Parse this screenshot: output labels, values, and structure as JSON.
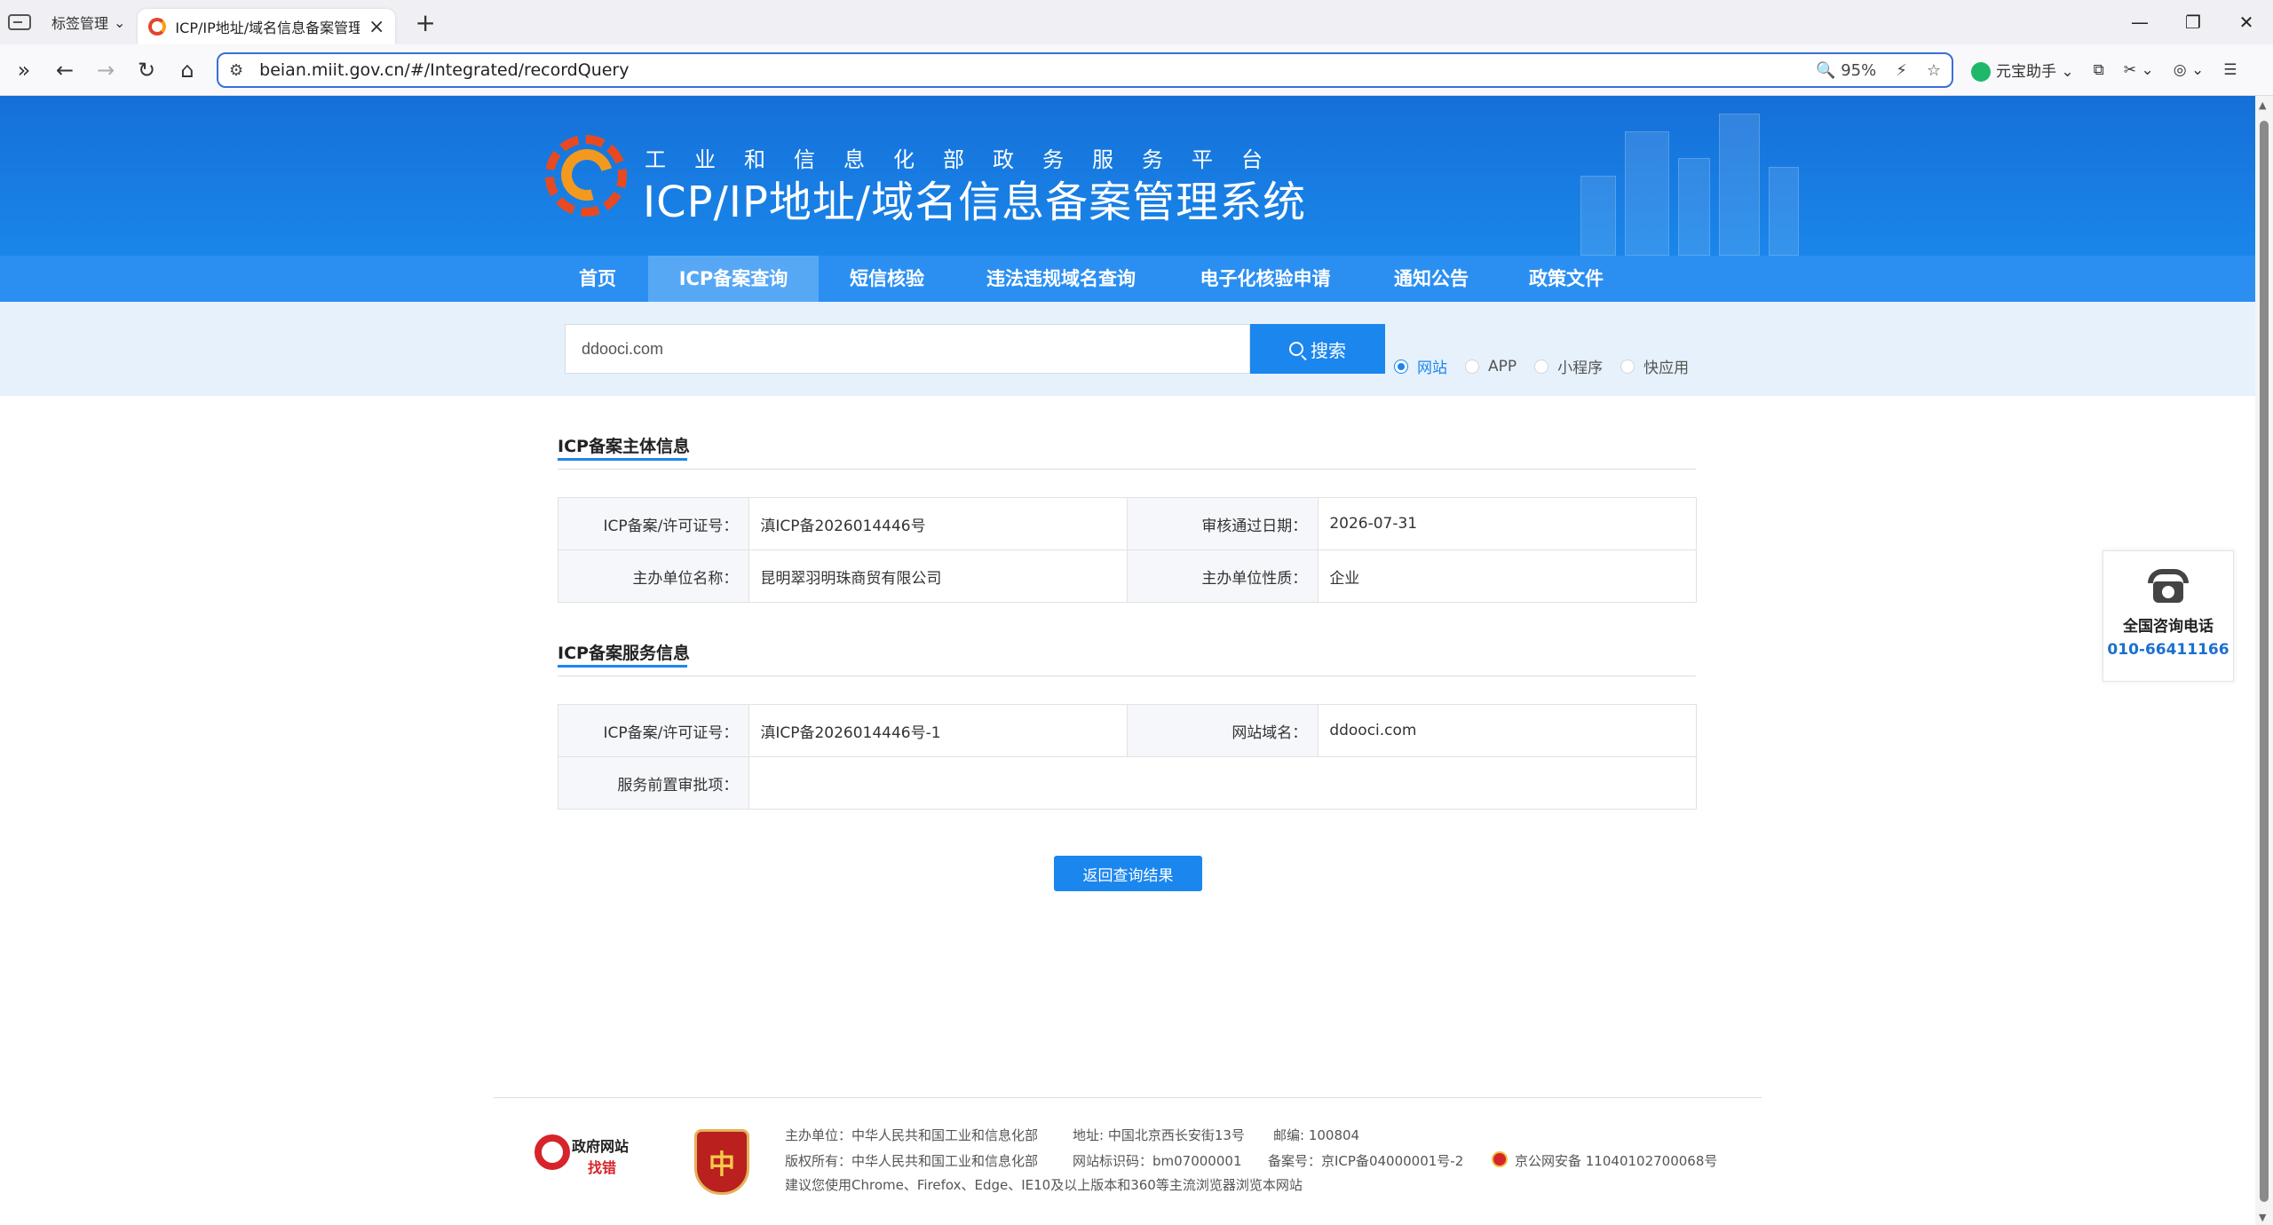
{
  "browser": {
    "tab_group_label": "标签管理",
    "active_tab_title": "ICP/IP地址/域名信息备案管理系",
    "url": "beian.miit.gov.cn/#/Integrated/recordQuery",
    "zoom": "95%",
    "assistant_label": "元宝助手"
  },
  "header": {
    "subtitle": "工业和信息化部政务服务平台",
    "title": "ICP/IP地址/域名信息备案管理系统"
  },
  "nav": [
    {
      "label": "首页"
    },
    {
      "label": "ICP备案查询"
    },
    {
      "label": "短信核验"
    },
    {
      "label": "违法违规域名查询"
    },
    {
      "label": "电子化核验申请"
    },
    {
      "label": "通知公告"
    },
    {
      "label": "政策文件"
    }
  ],
  "search": {
    "value": "ddooci.com",
    "button_label": "搜索",
    "options": [
      {
        "label": "网站",
        "checked": true
      },
      {
        "label": "APP",
        "checked": false
      },
      {
        "label": "小程序",
        "checked": false
      },
      {
        "label": "快应用",
        "checked": false
      }
    ]
  },
  "subject_section": {
    "title": "ICP备案主体信息",
    "rows": [
      {
        "label1": "ICP备案/许可证号：",
        "value1": "滇ICP备2026014446号",
        "label2": "审核通过日期：",
        "value2": "2026-07-31"
      },
      {
        "label1": "主办单位名称：",
        "value1": "昆明翠羽明珠商贸有限公司",
        "label2": "主办单位性质：",
        "value2": "企业"
      }
    ]
  },
  "service_section": {
    "title": "ICP备案服务信息",
    "row1": {
      "label1": "ICP备案/许可证号：",
      "value1": "滇ICP备2026014446号-1",
      "label2": "网站域名：",
      "value2": "ddooci.com"
    },
    "row2": {
      "label1": "服务前置审批项：",
      "value1": ""
    }
  },
  "back_button_label": "返回查询结果",
  "hotline": {
    "label": "全国咨询电话",
    "number": "010-66411166"
  },
  "footer": {
    "logo1_line1": "政府网站",
    "logo1_line2": "找错",
    "logo2_char": "中",
    "line1_a": "主办单位：中华人民共和国工业和信息化部",
    "line1_b": "地址: 中国北京西长安街13号",
    "line1_c": "邮编: 100804",
    "line2_a": "版权所有：中华人民共和国工业和信息化部",
    "line2_b": "网站标识码：bm07000001",
    "line2_c": "备案号：京ICP备04000001号-2",
    "line2_d": "京公网安备 11040102700068号",
    "line3": "建议您使用Chrome、Firefox、Edge、IE10及以上版本和360等主流浏览器浏览本网站"
  },
  "colors": {
    "primary": "#1b86ee",
    "nav_bar": "#2b8ff2",
    "header_bg": "#1570d8",
    "search_band": "#e6f1fc"
  }
}
